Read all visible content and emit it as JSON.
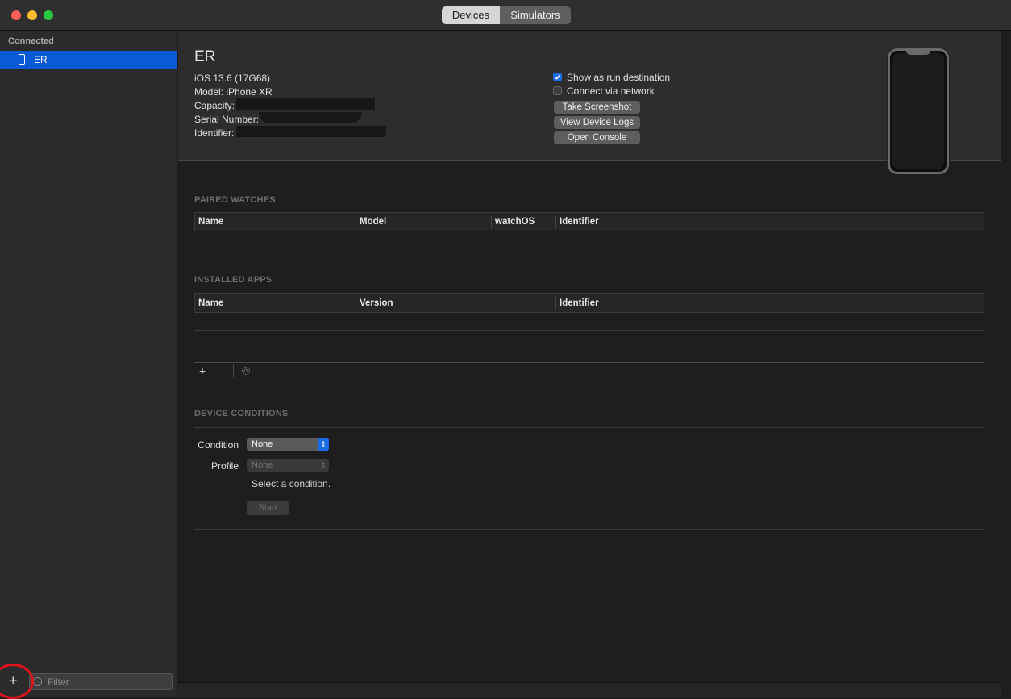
{
  "window": {
    "tabs": [
      {
        "label": "Devices",
        "selected": true
      },
      {
        "label": "Simulators",
        "selected": false
      }
    ]
  },
  "sidebar": {
    "section_header": "Connected",
    "items": [
      {
        "label": "ER",
        "selected": true
      }
    ],
    "add_label": "+",
    "filter_placeholder": "Filter"
  },
  "device": {
    "name": "ER",
    "os": "iOS 13.6 (17G68)",
    "model": "Model: iPhone XR",
    "capacity_label": "Capacity:",
    "serial_label": "Serial Number:",
    "identifier_label": "Identifier:",
    "show_as_run_destination": {
      "label": "Show as run destination",
      "checked": true
    },
    "connect_via_network": {
      "label": "Connect via network",
      "checked": false
    },
    "buttons": {
      "screenshot": "Take Screenshot",
      "device_logs": "View Device Logs",
      "console": "Open Console"
    }
  },
  "paired_watches": {
    "title": "PAIRED WATCHES",
    "columns": [
      "Name",
      "Model",
      "watchOS",
      "Identifier"
    ]
  },
  "installed_apps": {
    "title": "INSTALLED APPS",
    "columns": [
      "Name",
      "Version",
      "Identifier"
    ],
    "add": "+",
    "remove": "—"
  },
  "device_conditions": {
    "title": "DEVICE CONDITIONS",
    "condition_label": "Condition",
    "condition_value": "None",
    "profile_label": "Profile",
    "profile_value": "None",
    "hint": "Select a condition.",
    "start": "Start"
  },
  "colors": {
    "accent": "#0a5ad6",
    "annotation": "#e0121a"
  }
}
